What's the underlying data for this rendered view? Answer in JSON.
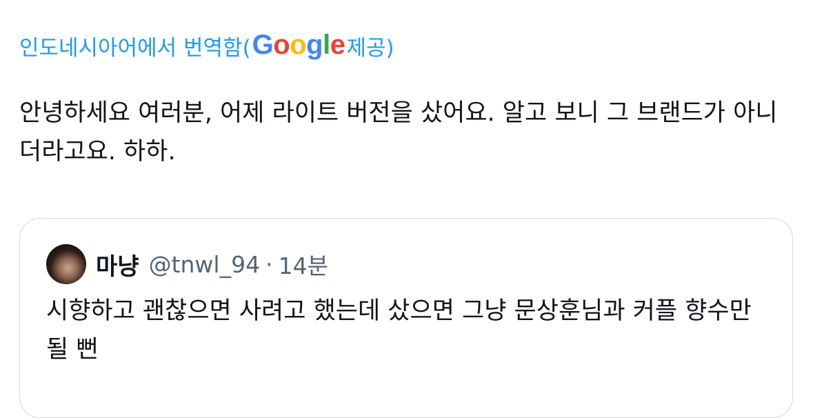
{
  "translation": {
    "prefix": "인도네시아어에서 번역함(",
    "provider_letters": [
      "G",
      "o",
      "o",
      "g",
      "l",
      "e"
    ],
    "suffix": " 제공)"
  },
  "tweet": {
    "text": "안녕하세요 여러분, 어제 라이트 버전을 샀어요. 알고 보니 그 브랜드가 아니더라고요. 하하."
  },
  "quoted_tweet": {
    "display_name": "마냥",
    "handle": "@tnwl_94",
    "separator": "·",
    "time": "14분",
    "text": "시향하고 괜찮으면 사려고 했는데 샀으면 그냥 문상훈님과 커플 향수만 될 뻔"
  },
  "colors": {
    "link_blue": "#1d9bf0",
    "text": "#0f1419",
    "secondary_text": "#536471",
    "border": "#cfd9de"
  },
  "icons": {
    "provider_logo": "google-logo",
    "avatar": "user-avatar"
  }
}
